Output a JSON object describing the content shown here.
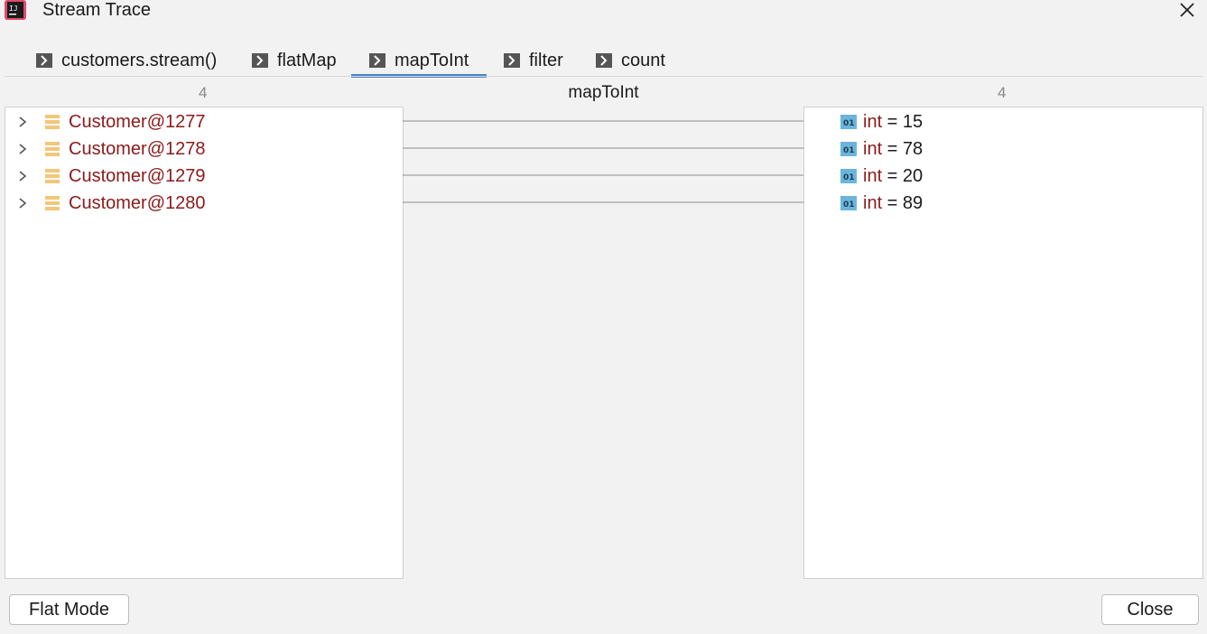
{
  "window": {
    "title": "Stream Trace",
    "app_icon": "intellij-idea-icon",
    "close_icon": "close-icon"
  },
  "tabs": [
    {
      "label": "customers.stream()",
      "active": false
    },
    {
      "label": "flatMap",
      "active": false
    },
    {
      "label": "mapToInt",
      "active": true
    },
    {
      "label": "filter",
      "active": false
    },
    {
      "label": "count",
      "active": false
    }
  ],
  "header": {
    "left_count": "4",
    "stage": "mapToInt",
    "right_count": "4"
  },
  "left_items": [
    {
      "label": "Customer@1277"
    },
    {
      "label": "Customer@1278"
    },
    {
      "label": "Customer@1279"
    },
    {
      "label": "Customer@1280"
    }
  ],
  "right_items": [
    {
      "type": "int",
      "eq": " = ",
      "value": "15"
    },
    {
      "type": "int",
      "eq": " = ",
      "value": "78"
    },
    {
      "type": "int",
      "eq": " = ",
      "value": "20"
    },
    {
      "type": "int",
      "eq": " = ",
      "value": "89"
    }
  ],
  "buttons": {
    "flat_mode": "Flat Mode",
    "close": "Close"
  },
  "colors": {
    "accent": "#4a84c5",
    "object_label": "#8b1a1a",
    "value_icon": "#6bb5dc",
    "object_icon": "#f2c77a"
  }
}
